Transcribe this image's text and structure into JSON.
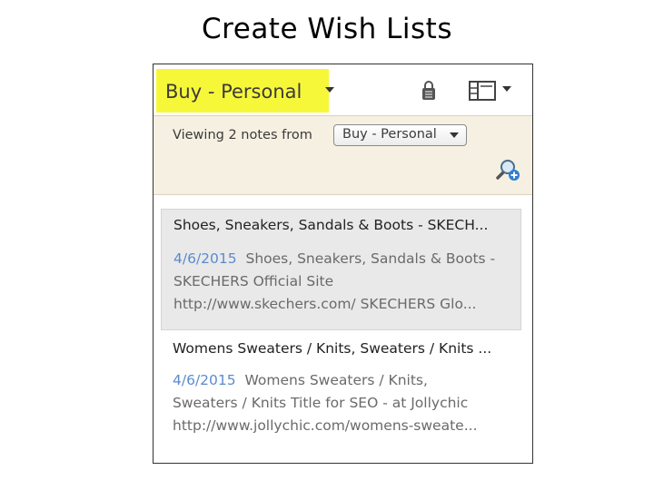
{
  "slide": {
    "title": "Create Wish Lists"
  },
  "header": {
    "notebook_name": "Buy - Personal",
    "share_icon": "lock-share-icon",
    "view_icon": "card-view-icon"
  },
  "filter": {
    "viewing_text": "Viewing 2 notes from",
    "notebook_select": "Buy - Personal",
    "search_icon": "magnifier-add-icon"
  },
  "notes": [
    {
      "title": "Shoes, Sneakers, Sandals & Boots - SKECH...",
      "date": "4/6/2015",
      "snippet_line1": "Shoes, Sneakers, Sandals & Boots -",
      "snippet_line2": "SKECHERS Official Site",
      "snippet_line3": "http://www.skechers.com/ SKECHERS Glo...",
      "selected": true
    },
    {
      "title": "Womens Sweaters / Knits, Sweaters / Knits ...",
      "date": "4/6/2015",
      "snippet_line1": "Womens Sweaters / Knits,",
      "snippet_line2": "Sweaters / Knits Title for SEO - at Jollychic",
      "snippet_line3": "http://www.jollychic.com/womens-sweate...",
      "selected": false
    }
  ],
  "colors": {
    "highlight": "#f7f73a",
    "filter_bar": "#f5f0e1",
    "date": "#5b8bd0",
    "selected_note": "#e9e9e9"
  }
}
